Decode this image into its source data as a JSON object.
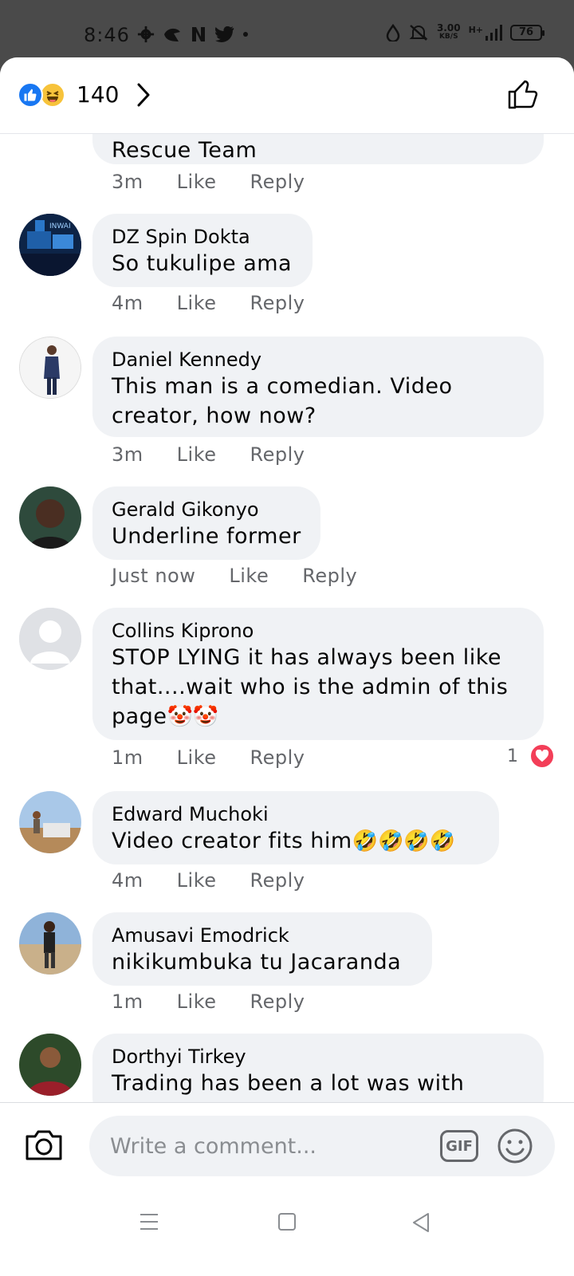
{
  "status_bar": {
    "time": "8:46",
    "speed_value": "3.00",
    "speed_unit": "KB/S",
    "network": "H+",
    "battery": "76"
  },
  "header": {
    "reaction_count": "140"
  },
  "comments": [
    {
      "name": "",
      "text": "Rescue Team",
      "time": "3m",
      "like": "Like",
      "reply": "Reply"
    },
    {
      "name": "DZ Spin Dokta",
      "text": "So tukulipe ama",
      "time": "4m",
      "like": "Like",
      "reply": "Reply"
    },
    {
      "name": "Daniel Kennedy",
      "text": "This man is a comedian. Video creator, how now?",
      "time": "3m",
      "like": "Like",
      "reply": "Reply"
    },
    {
      "name": "Gerald Gikonyo",
      "text": "Underline former",
      "time": "Just now",
      "like": "Like",
      "reply": "Reply"
    },
    {
      "name": "Collins Kiprono",
      "text": "STOP LYING it has always been like that....wait who is the admin of this page",
      "emoji": "🤡🤡",
      "time": "1m",
      "like": "Like",
      "reply": "Reply",
      "reaction_count": "1"
    },
    {
      "name": "Edward Muchoki",
      "text": "Video creator fits him",
      "emoji": "🤣🤣🤣🤣",
      "time": "4m",
      "like": "Like",
      "reply": "Reply"
    },
    {
      "name": "Amusavi Emodrick",
      "text": "nikikumbuka tu Jacaranda",
      "time": "1m",
      "like": "Like",
      "reply": "Reply"
    },
    {
      "name": "Dorthyi Tirkey",
      "text": "Trading has been a lot was with",
      "time": "",
      "like": "",
      "reply": ""
    }
  ],
  "composer": {
    "placeholder": "Write a comment...",
    "gif_label": "GIF"
  },
  "colors": {
    "accent": "#1877f2",
    "bubble": "#f0f2f5",
    "meta_text": "#65676b",
    "heart": "#f33e58"
  },
  "icons": [
    "settings-icon",
    "app-icon",
    "netflix-icon",
    "twitter-icon",
    "data-saver-icon",
    "mute-icon",
    "signal-icon",
    "battery-icon",
    "like-reaction-icon",
    "haha-reaction-icon",
    "chevron-right-icon",
    "thumbs-up-icon",
    "camera-icon",
    "gif-icon",
    "smiley-icon",
    "heart-reaction-icon",
    "menu-nav-icon",
    "home-nav-icon",
    "back-nav-icon"
  ]
}
